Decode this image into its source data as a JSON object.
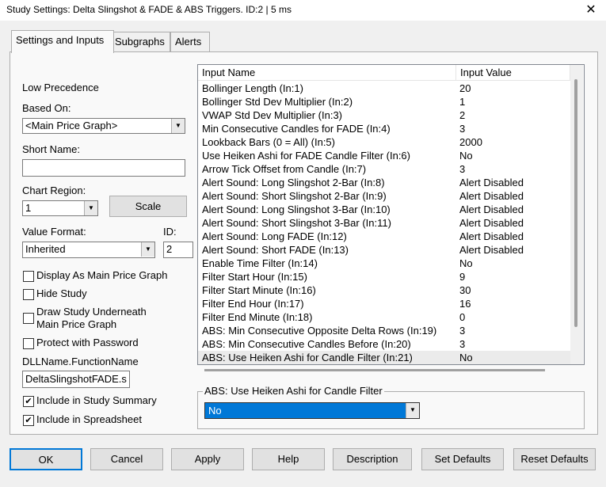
{
  "window": {
    "title": "Study Settings: Delta Slingshot & FADE & ABS Triggers. ID:2 | 5 ms",
    "close": "✕"
  },
  "tabs": [
    "Settings and Inputs",
    "Subgraphs",
    "Alerts"
  ],
  "left": {
    "precedence": "Low Precedence",
    "based_on_label": "Based On:",
    "based_on_value": "<Main Price Graph>",
    "short_name_label": "Short Name:",
    "short_name_value": "",
    "chart_region_label": "Chart Region:",
    "chart_region_value": "1",
    "scale_button": "Scale",
    "value_format_label": "Value Format:",
    "value_format_value": "Inherited",
    "id_label": "ID:",
    "id_value": "2",
    "checkboxes": [
      {
        "label": "Display As Main Price Graph",
        "checked": ""
      },
      {
        "label": "Hide Study",
        "checked": ""
      },
      {
        "label": "Draw Study Underneath",
        "label2": "Main Price Graph",
        "checked": ""
      },
      {
        "label": "Protect with Password",
        "checked": ""
      }
    ],
    "dll_label": "DLLName.FunctionName",
    "dll_value": "DeltaSlingshotFADE.s",
    "summary_checkboxes": [
      {
        "label": "Include in Study Summary",
        "checked": "✔"
      },
      {
        "label": "Include in Spreadsheet",
        "checked": "✔"
      }
    ]
  },
  "grid": {
    "headers": [
      "Input Name",
      "Input Value"
    ],
    "rows": [
      {
        "name": "Bollinger Length  (In:1)",
        "value": "20"
      },
      {
        "name": "Bollinger Std Dev Multiplier  (In:2)",
        "value": "1"
      },
      {
        "name": "VWAP Std Dev Multiplier  (In:3)",
        "value": "2"
      },
      {
        "name": "Min Consecutive Candles for FADE  (In:4)",
        "value": "3"
      },
      {
        "name": "Lookback Bars (0 = All)  (In:5)",
        "value": "2000"
      },
      {
        "name": "Use Heiken Ashi for FADE Candle Filter  (In:6)",
        "value": "No"
      },
      {
        "name": "Arrow Tick Offset from Candle  (In:7)",
        "value": "3"
      },
      {
        "name": "Alert Sound: Long Slingshot 2-Bar  (In:8)",
        "value": "Alert Disabled"
      },
      {
        "name": "Alert Sound: Short Slingshot 2-Bar  (In:9)",
        "value": "Alert Disabled"
      },
      {
        "name": "Alert Sound: Long Slingshot 3-Bar  (In:10)",
        "value": "Alert Disabled"
      },
      {
        "name": "Alert Sound: Short Slingshot 3-Bar  (In:11)",
        "value": "Alert Disabled"
      },
      {
        "name": "Alert Sound: Long FADE  (In:12)",
        "value": "Alert Disabled"
      },
      {
        "name": "Alert Sound: Short FADE  (In:13)",
        "value": "Alert Disabled"
      },
      {
        "name": "Enable Time Filter  (In:14)",
        "value": "No"
      },
      {
        "name": "Filter Start Hour  (In:15)",
        "value": "9"
      },
      {
        "name": "Filter Start Minute  (In:16)",
        "value": "30"
      },
      {
        "name": "Filter End Hour  (In:17)",
        "value": "16"
      },
      {
        "name": "Filter End Minute  (In:18)",
        "value": "0"
      },
      {
        "name": "ABS: Min Consecutive Opposite Delta Rows  (In:19)",
        "value": "3"
      },
      {
        "name": "ABS: Min Consecutive Candles Before  (In:20)",
        "value": "3"
      },
      {
        "name": "ABS: Use Heiken Ashi for Candle Filter  (In:21)",
        "value": "No"
      }
    ]
  },
  "editor": {
    "title": "ABS: Use Heiken Ashi for Candle Filter",
    "value": "No"
  },
  "buttons": [
    "OK",
    "Cancel",
    "Apply",
    "Help",
    "Description",
    "Set Defaults",
    "Reset Defaults"
  ]
}
